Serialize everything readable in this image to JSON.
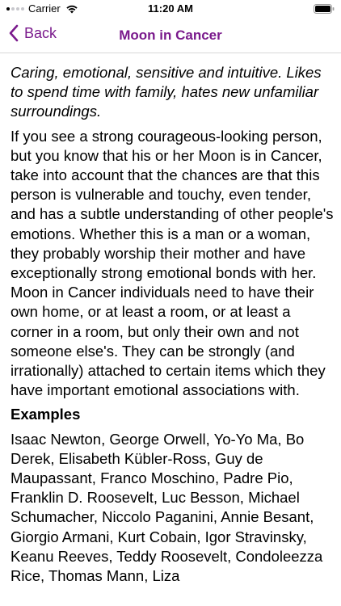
{
  "status_bar": {
    "carrier": "Carrier",
    "time": "11:20 AM"
  },
  "nav": {
    "back_label": "Back",
    "title": "Moon in Cancer",
    "accent_color": "#7a1a8c"
  },
  "content": {
    "intro": "Caring, emotional, sensitive and intuitive. Likes to spend time with family, hates new unfamiliar surroundings.",
    "body": "If you see a strong courageous-looking person, but you know that his or her Moon is in Cancer, take into account that the chances are that this person is vulnerable and touchy, even tender, and has a subtle understanding of other people's emotions. Whether this is a man or a woman, they probably worship their mother and have exceptionally strong emotional bonds with her. Moon in Cancer individuals need to have their own home, or at least a room, or at least a corner in a room, but only their own and not someone else's. They can be strongly (and irrationally) attached to certain items which they have important emotional associations with.",
    "examples_heading": "Examples",
    "examples": "Isaac Newton, George Orwell, Yo-Yo Ma, Bo Derek, Elisabeth Kübler-Ross, Guy de Maupassant, Franco Moschino, Padre Pio, Franklin D. Roosevelt, Luc Besson, Michael Schumacher, Niccolo Paganini, Annie Besant, Giorgio Armani, Kurt Cobain, Igor Stravinsky, Keanu Reeves, Teddy Roosevelt, Condoleezza Rice, Thomas Mann, Liza"
  }
}
